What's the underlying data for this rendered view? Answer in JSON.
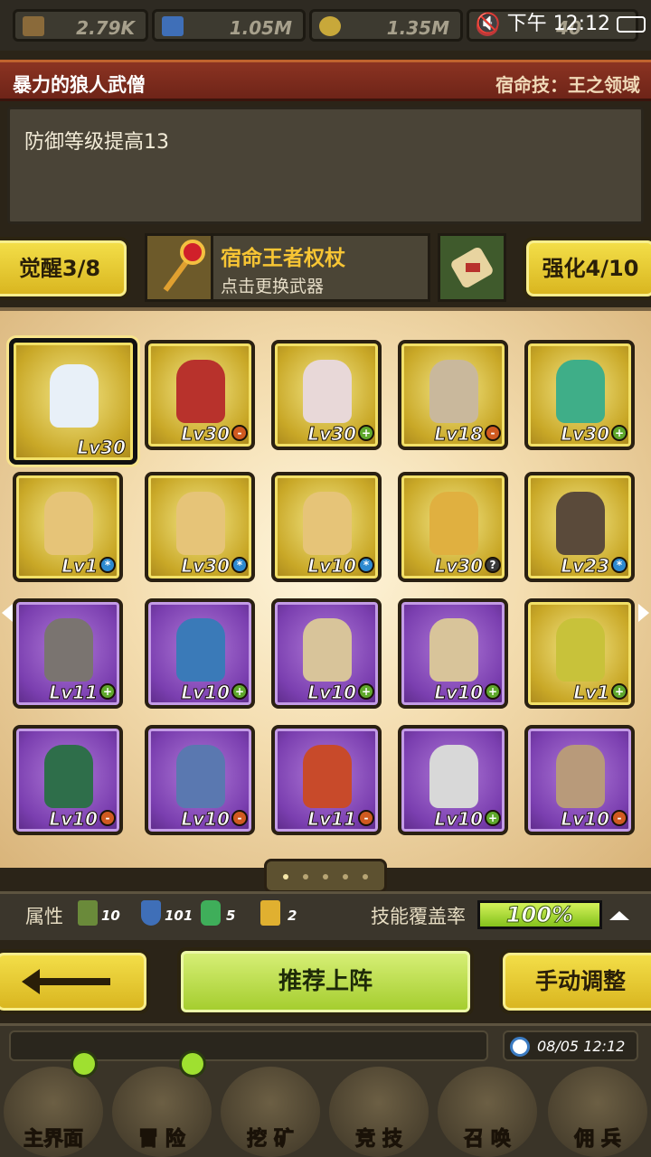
{
  "resources": {
    "gold_per": "2.79K",
    "exp": "1.05M",
    "coins": "1.35M",
    "gem": "40"
  },
  "system": {
    "time": "下午 12:12"
  },
  "hero": {
    "name": "暴力的狼人武僧",
    "destiny_skill": "宿命技：王之领域",
    "description": "防御等级提高13"
  },
  "weapon": {
    "awaken": "觉醒3/8",
    "name": "宿命王者权杖",
    "hint": "点击更换武器",
    "enhance": "强化4/10"
  },
  "cards": [
    {
      "lv": "Lv30",
      "badge": "",
      "style": "gold",
      "sel": true,
      "fig": "#e8f0f8"
    },
    {
      "lv": "Lv30",
      "badge": "-",
      "style": "gold",
      "sel": false,
      "fig": "#b8322c"
    },
    {
      "lv": "Lv30",
      "badge": "+",
      "style": "gold",
      "sel": false,
      "fig": "#e8d8d8"
    },
    {
      "lv": "Lv18",
      "badge": "-",
      "style": "gold",
      "sel": false,
      "fig": "#c9b89c"
    },
    {
      "lv": "Lv30",
      "badge": "+",
      "style": "gold",
      "sel": false,
      "fig": "#3fae88"
    },
    {
      "lv": "Lv1",
      "badge": "*",
      "style": "gold",
      "sel": false,
      "fig": "#e6c478"
    },
    {
      "lv": "Lv30",
      "badge": "*",
      "style": "gold",
      "sel": false,
      "fig": "#e6c478"
    },
    {
      "lv": "Lv10",
      "badge": "*",
      "style": "gold",
      "sel": false,
      "fig": "#e6c478"
    },
    {
      "lv": "Lv30",
      "badge": "?",
      "style": "gold",
      "sel": false,
      "fig": "#e0b040"
    },
    {
      "lv": "Lv23",
      "badge": "*",
      "style": "gold",
      "sel": false,
      "fig": "#5a4a3a"
    },
    {
      "lv": "Lv11",
      "badge": "+",
      "style": "purple",
      "sel": false,
      "fig": "#7a7470"
    },
    {
      "lv": "Lv10",
      "badge": "+",
      "style": "purple",
      "sel": false,
      "fig": "#3a7ab8"
    },
    {
      "lv": "Lv10",
      "badge": "+",
      "style": "purple",
      "sel": false,
      "fig": "#d8c49a"
    },
    {
      "lv": "Lv10",
      "badge": "+",
      "style": "purple",
      "sel": false,
      "fig": "#d8c49a"
    },
    {
      "lv": "Lv1",
      "badge": "+",
      "style": "gold",
      "sel": false,
      "fig": "#c8c23a"
    },
    {
      "lv": "Lv10",
      "badge": "-",
      "style": "purple",
      "sel": false,
      "fig": "#2e6e4a"
    },
    {
      "lv": "Lv10",
      "badge": "-",
      "style": "purple",
      "sel": false,
      "fig": "#5a78b0"
    },
    {
      "lv": "Lv11",
      "badge": "-",
      "style": "purple",
      "sel": false,
      "fig": "#c84a2a"
    },
    {
      "lv": "Lv10",
      "badge": "+",
      "style": "purple",
      "sel": false,
      "fig": "#d8d8d8"
    },
    {
      "lv": "Lv10",
      "badge": "-",
      "style": "purple",
      "sel": false,
      "fig": "#b89a7a"
    }
  ],
  "stats": {
    "label": "属性",
    "attack": "10",
    "defense": "101",
    "speed": "5",
    "crown": "2",
    "coverage_label": "技能覆盖率",
    "coverage": "100%",
    "coverage_fraction": 1.0
  },
  "actions": {
    "recommend": "推荐上阵",
    "manual": "手动调整"
  },
  "datetime": "08/05 12:12",
  "nav": [
    {
      "label": "主界面",
      "dot": true
    },
    {
      "label": "冒 险",
      "dot": true
    },
    {
      "label": "挖 矿",
      "dot": false
    },
    {
      "label": "竞 技",
      "dot": false
    },
    {
      "label": "召 唤",
      "dot": false
    },
    {
      "label": "佣 兵",
      "dot": false
    }
  ],
  "colors": {
    "accent_gold": "#f7c534",
    "card_gold": "#c9a827",
    "card_purple": "#7b3fb0",
    "green_button": "#a3cc2c"
  }
}
